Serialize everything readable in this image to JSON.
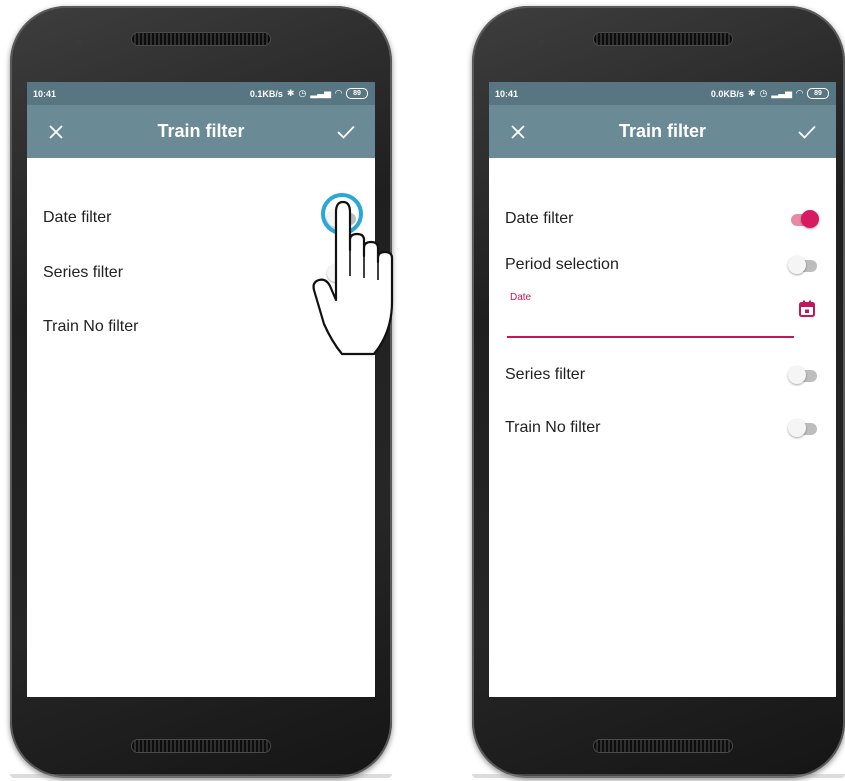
{
  "colors": {
    "accent": "#d81b60",
    "statusbar": "#587682",
    "toolbar": "#6a8a96",
    "ripple": "#29a8d8"
  },
  "left_screen": {
    "status": {
      "time": "10:41",
      "net_speed": "0.1KB/s",
      "battery": "89"
    },
    "toolbar": {
      "close_icon": "close-icon",
      "title": "Train filter",
      "confirm_icon": "check-icon"
    },
    "filters": [
      {
        "label": "Date filter",
        "enabled": false
      },
      {
        "label": "Series filter",
        "enabled": false
      },
      {
        "label": "Train No filter",
        "enabled": false
      }
    ],
    "overlay_icon": "pointing-hand-icon"
  },
  "right_screen": {
    "status": {
      "time": "10:41",
      "net_speed": "0.0KB/s",
      "battery": "89"
    },
    "toolbar": {
      "close_icon": "close-icon",
      "title": "Train filter",
      "confirm_icon": "check-icon"
    },
    "date_filter": {
      "label": "Date filter",
      "enabled": true
    },
    "period_selection": {
      "label": "Period selection",
      "enabled": false
    },
    "date_field": {
      "label": "Date",
      "value": "",
      "icon": "calendar-icon"
    },
    "series_filter": {
      "label": "Series filter",
      "enabled": false
    },
    "train_no_filter": {
      "label": "Train No filter",
      "enabled": false
    }
  }
}
